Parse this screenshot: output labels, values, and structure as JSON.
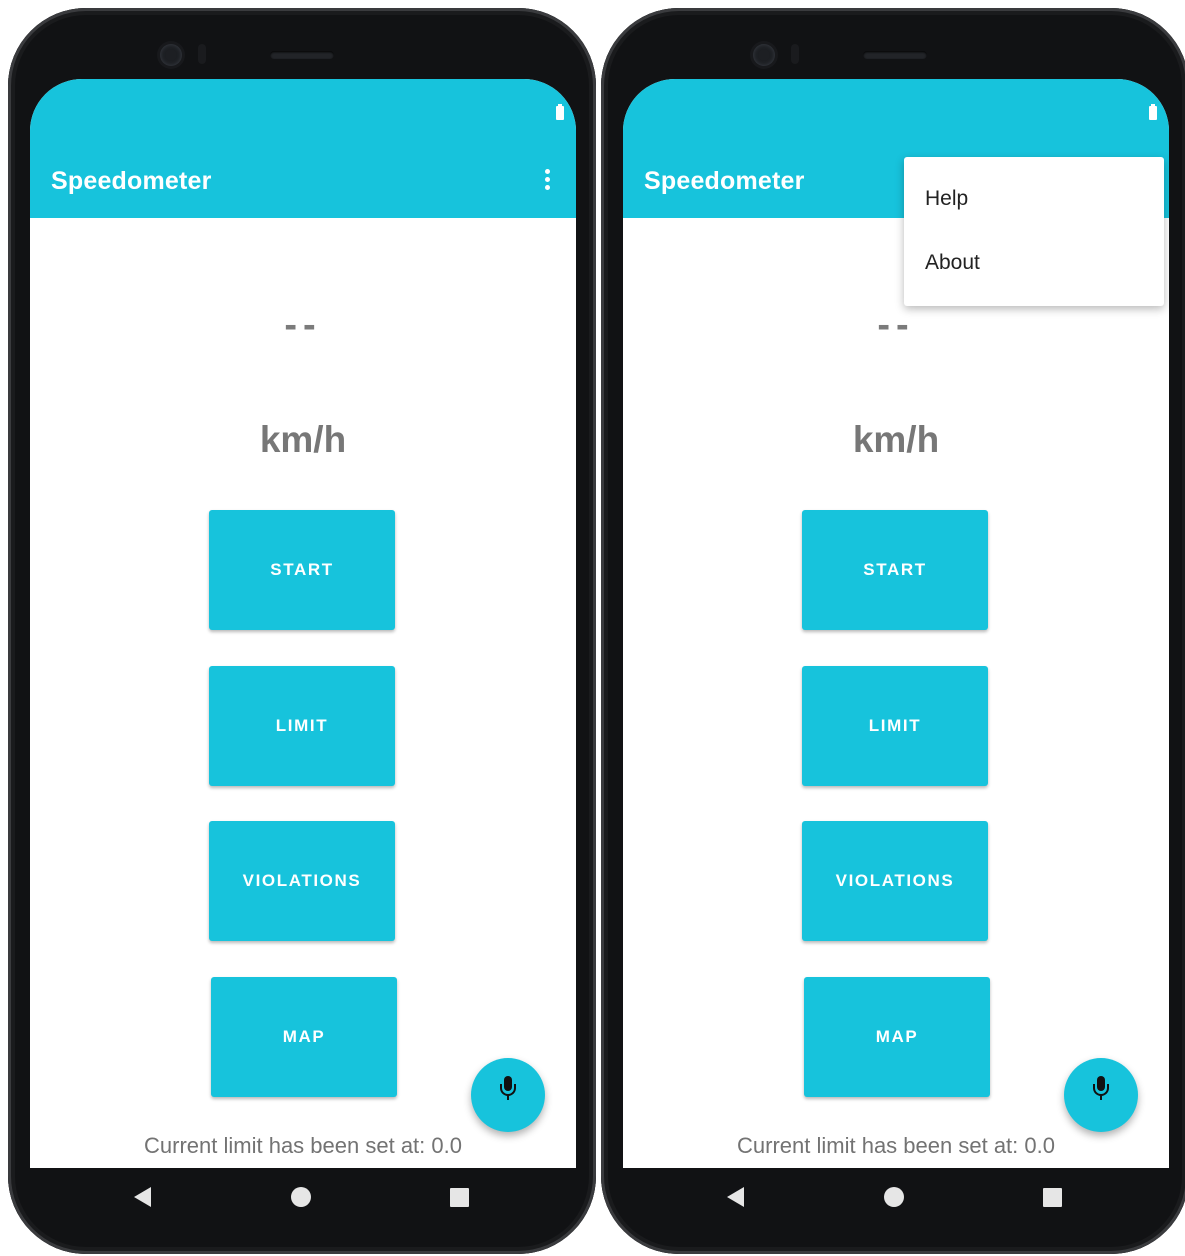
{
  "screens": [
    {
      "id": "main",
      "app_title": "Speedometer",
      "speed_value": "--",
      "speed_unit": "km/h",
      "buttons": {
        "start": "START",
        "limit": "LIMIT",
        "violations": "VIOLATIONS",
        "map": "MAP"
      },
      "status_text": "Current limit has been set at: 0.0",
      "overflow_menu_open": false
    },
    {
      "id": "menu-open",
      "app_title": "Speedometer",
      "speed_value": "--",
      "speed_unit": "km/h",
      "buttons": {
        "start": "START",
        "limit": "LIMIT",
        "violations": "VIOLATIONS",
        "map": "MAP"
      },
      "status_text": "Current limit has been set at: 0.0",
      "overflow_menu_open": true,
      "menu_items": [
        "Help",
        "About"
      ]
    }
  ],
  "icons": {
    "overflow": "more-vert-icon",
    "fab": "microphone-icon",
    "battery": "battery-icon",
    "nav_back": "back-triangle-icon",
    "nav_home": "home-circle-icon",
    "nav_recents": "recents-square-icon"
  },
  "colors": {
    "accent": "#17c3dc",
    "phone_frame": "#111214",
    "secondary_text": "#777777"
  }
}
